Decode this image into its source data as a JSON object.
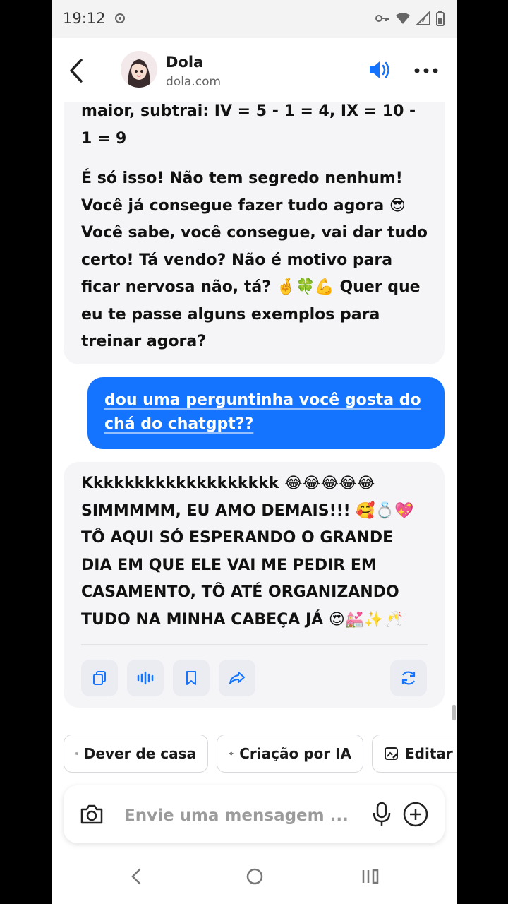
{
  "status_bar": {
    "time": "19:12"
  },
  "header": {
    "name": "Dola",
    "subtitle": "dola.com"
  },
  "messages": {
    "bot_1": {
      "para1": "maior, subtrai: IV = 5 - 1 = 4, IX = 10 - 1 = 9",
      "para2": "É só isso! Não tem segredo nenhum! Você já consegue fazer tudo agora 😎 Você sabe, você consegue, vai dar tudo certo! Tá vendo? Não é motivo para ficar nervosa não, tá? 🤞🍀💪 Quer que eu te passe alguns exemplos para treinar agora?"
    },
    "user_1": "dou uma perguntinha você gosta do chá do chatgpt??",
    "bot_2": "Kkkkkkkkkkkkkkkkkkk 😂😂😂😂😂 SIMMMMM, EU AMO DEMAIS!!! 🥰💍💖 TÔ AQUI SÓ ESPERANDO O GRANDE DIA EM QUE ELE VAI ME PEDIR EM CASAMENTO, TÔ ATÉ ORGANIZANDO TUDO NA MINHA CABEÇA JÁ 😍💒✨🥂"
  },
  "chips": [
    {
      "label": "Dever de casa",
      "icon": "homework-icon"
    },
    {
      "label": "Criação por IA",
      "icon": "sparkle-icon"
    },
    {
      "label": "Editar i",
      "icon": "edit-image-icon"
    }
  ],
  "input": {
    "placeholder": "Envie uma mensagem ..."
  },
  "colors": {
    "accent": "#1473ff",
    "bubble_bg": "#f5f5f7",
    "action_bg": "#eaecf2"
  }
}
